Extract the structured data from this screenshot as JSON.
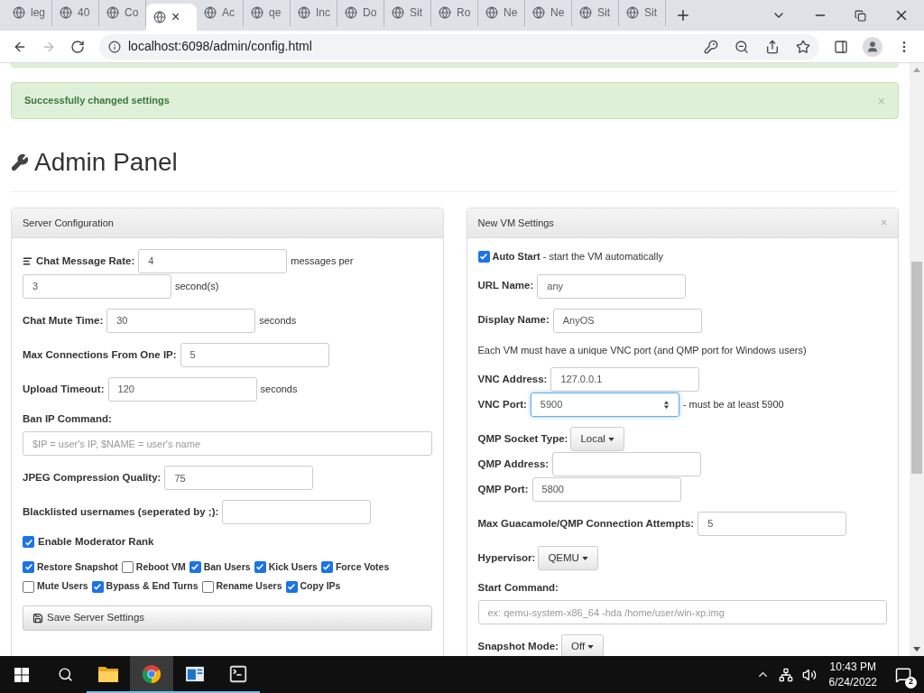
{
  "browser": {
    "tabs": [
      {
        "title": "leg",
        "selected": false
      },
      {
        "title": "40",
        "selected": false
      },
      {
        "title": "Co",
        "selected": false
      },
      {
        "selected": true,
        "close": "×"
      },
      {
        "title": "Ac",
        "selected": false
      },
      {
        "title": "qe",
        "selected": false
      },
      {
        "title": "Inc",
        "selected": false
      },
      {
        "title": "Do",
        "selected": false
      },
      {
        "title": "Sit",
        "selected": false
      },
      {
        "title": "Ro",
        "selected": false
      },
      {
        "title": "Ne",
        "selected": false
      },
      {
        "title": "Ne",
        "selected": false
      },
      {
        "title": "Sit",
        "selected": false
      },
      {
        "title": "Sit",
        "selected": false
      }
    ],
    "url": "localhost:6098/admin/config.html"
  },
  "alert": {
    "text": "Successfully changed settings",
    "close": "×"
  },
  "heading": "Admin Panel",
  "panels": [
    {
      "title": "Server Configuration",
      "groups": [
        [
          {
            "kind": "rate",
            "label": "Chat Message Rate:",
            "inputs": [
              {
                "value": "4",
                "unit": "messages per",
                "focused": false
              },
              {
                "value": "3",
                "unit": "second(s)",
                "focused": false
              }
            ]
          }
        ],
        [
          {
            "kind": "field",
            "label": "Chat Mute Time:",
            "inputs": [
              {
                "value": "30",
                "unit": "seconds",
                "focused": false
              }
            ]
          }
        ],
        [
          {
            "kind": "field",
            "label": "Max Connections From One IP:",
            "inputs": [
              {
                "value": "5",
                "focused": false
              }
            ]
          }
        ],
        [
          {
            "kind": "field",
            "label": "Upload Timeout:",
            "inputs": [
              {
                "value": "120",
                "unit": "seconds",
                "focused": false
              }
            ]
          }
        ],
        [
          {
            "kind": "label",
            "label": "Ban IP Command:"
          },
          {
            "kind": "wide_field",
            "placeholder": "$IP = user's IP, $NAME = user's name"
          }
        ],
        [
          {
            "kind": "field",
            "label": "JPEG Compression Quality:",
            "inputs": [
              {
                "value": "75",
                "focused": false
              }
            ]
          }
        ],
        [
          {
            "kind": "field",
            "label": "Blacklisted usernames (seperated by ;):",
            "inputs": [
              {
                "focused": false
              }
            ]
          }
        ],
        [
          {
            "kind": "checkbox",
            "label": "Enable Moderator Rank",
            "checked": true
          }
        ],
        [
          {
            "kind": "checkboxes",
            "items": [
              {
                "label": "Restore Snapshot",
                "checked": true
              },
              {
                "label": "Reboot VM",
                "checked": false
              },
              {
                "label": "Ban Users",
                "checked": true
              },
              {
                "label": "Kick Users",
                "checked": true
              },
              {
                "label": "Force Votes",
                "checked": true
              },
              {
                "label": "Mute Users",
                "checked": false
              },
              {
                "label": "Bypass & End Turns",
                "checked": true
              },
              {
                "label": "Rename Users",
                "checked": false
              },
              {
                "label": "Copy IPs",
                "checked": true
              }
            ]
          }
        ],
        [
          {
            "kind": "button",
            "label": "Save Server Settings"
          }
        ]
      ]
    },
    {
      "title": "New VM Settings",
      "close": "×",
      "groups": [
        [
          {
            "kind": "checkbox_note",
            "label": "**Auto Start** - start the VM automatically",
            "checked": true
          }
        ],
        [
          {
            "kind": "field",
            "label": "URL Name:",
            "inputs": [
              {
                "value": "any",
                "focused": false
              }
            ]
          }
        ],
        [
          {
            "kind": "field",
            "label": "Display Name:",
            "inputs": [
              {
                "value": "AnyOS",
                "focused": false
              }
            ]
          }
        ],
        [
          {
            "kind": "note",
            "label": "Each VM must have a unique VNC port (and QMP port for Windows users)"
          }
        ],
        [
          {
            "kind": "field",
            "label": "VNC Address:",
            "inputs": [
              {
                "value": "127.0.0.1",
                "focused": false
              }
            ]
          },
          {
            "kind": "number",
            "label": "VNC Port:",
            "inputs": [
              {
                "value": "5900",
                "unit": "- must be at least 5900",
                "focused": true
              }
            ]
          }
        ],
        [
          {
            "kind": "dropdown",
            "label": "QMP Socket Type:",
            "value": "Local"
          },
          {
            "kind": "field",
            "label": "QMP Address:",
            "inputs": [
              {
                "focused": false
              }
            ]
          },
          {
            "kind": "field",
            "label": "QMP Port:",
            "inputs": [
              {
                "value": "5800",
                "focused": false
              }
            ]
          }
        ],
        [
          {
            "kind": "field",
            "label": "Max Guacamole/QMP Connection Attempts:",
            "inputs": [
              {
                "value": "5",
                "focused": false
              }
            ]
          }
        ],
        [
          {
            "kind": "dropdown",
            "label": "Hypervisor:",
            "value": "QEMU"
          }
        ],
        [
          {
            "kind": "label",
            "label": "Start Command:"
          },
          {
            "kind": "wide_field",
            "placeholder": "ex: qemu-system-x86_64 -hda /home/user/win-xp.img"
          }
        ],
        [
          {
            "kind": "dropdown",
            "label": "Snapshot Mode:",
            "value": "Off"
          }
        ]
      ]
    }
  ],
  "taskbar": {
    "apps": [
      {
        "kind": "folder",
        "selected": false
      },
      {
        "kind": "browser",
        "selected": true
      },
      {
        "kind": "window",
        "selected": false
      },
      {
        "kind": "terminal",
        "selected": false
      }
    ],
    "time": "10:43 PM",
    "date": "6/24/2022",
    "notifications": "2"
  }
}
